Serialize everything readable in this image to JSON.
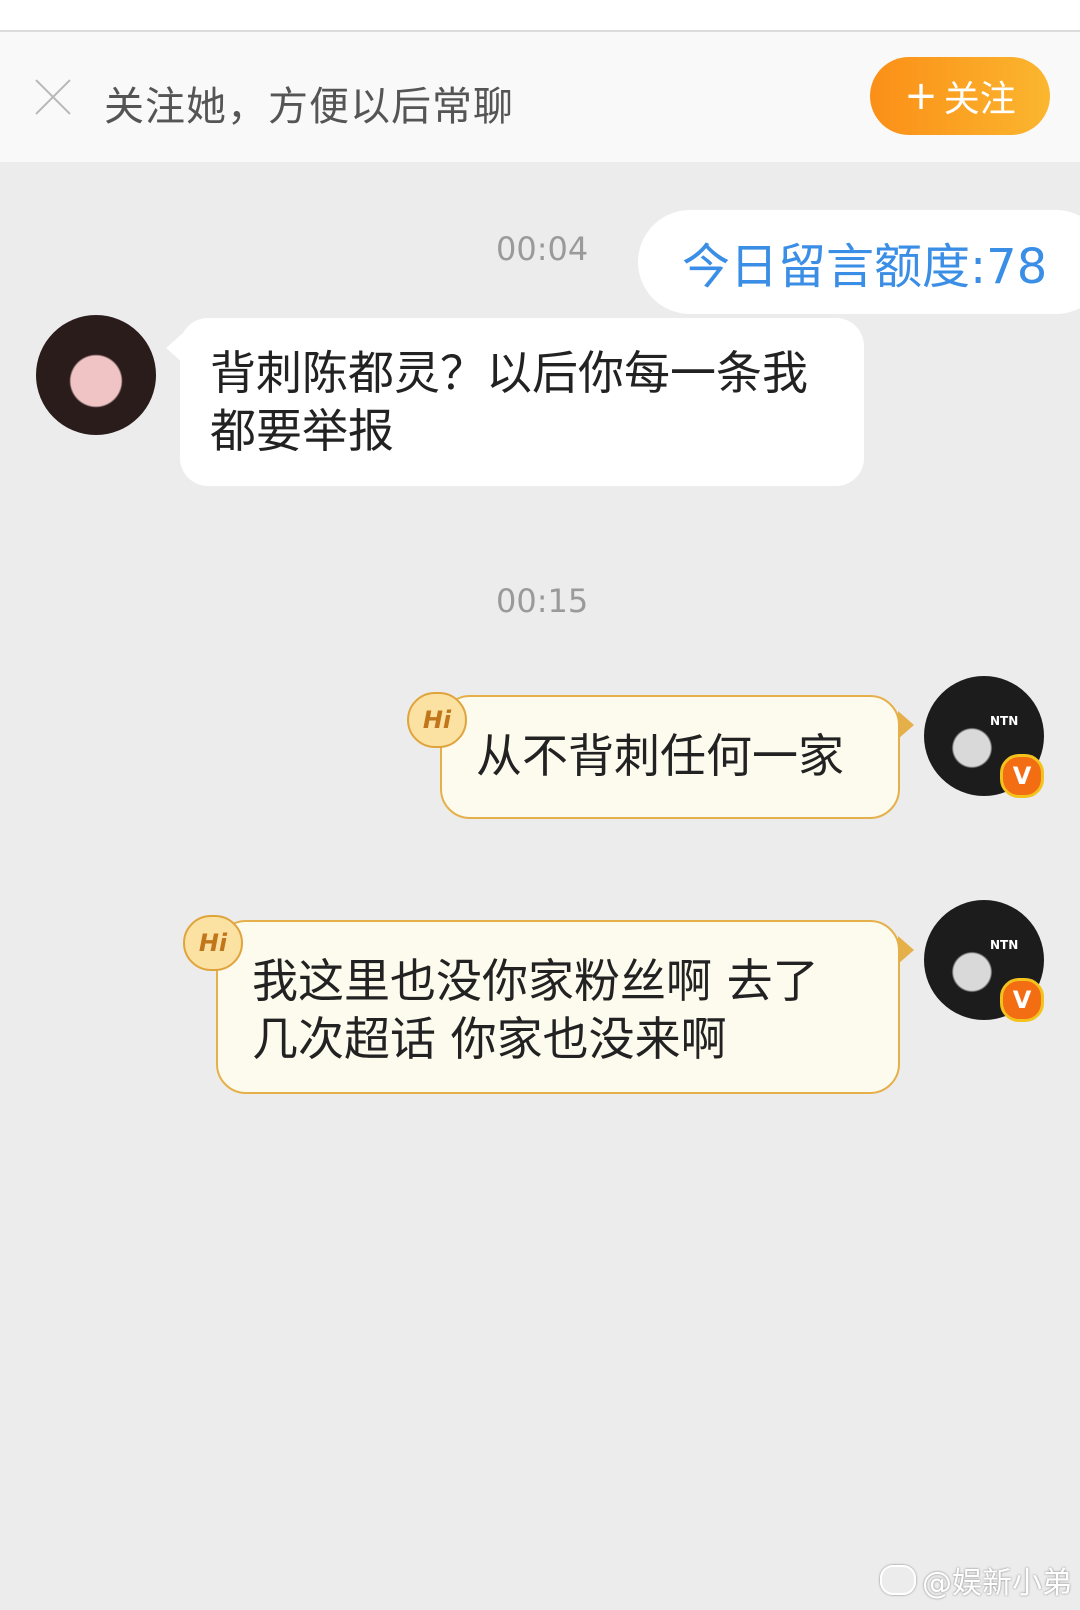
{
  "follow_bar": {
    "hint": "关注她，方便以后常聊",
    "follow_button": "关注",
    "follow_button_icon": "plus-icon",
    "close_icon": "close-icon"
  },
  "messages": [
    {
      "time": "00:04"
    },
    {
      "quota_text": "今日留言额度:78"
    },
    {
      "sender": "her",
      "text_line1": "背刺陈都灵？以后你每一条我",
      "text_line2": "都要举报"
    },
    {
      "time": "00:15"
    },
    {
      "sender": "him",
      "hi_badge": "Hi",
      "text_line1": "从不背刺任何一家",
      "verified_badge": "V"
    },
    {
      "sender": "him",
      "hi_badge": "Hi",
      "text_line1": "我这里也没你家粉丝啊 去了",
      "text_line2": "几次超话 你家也没来啊",
      "verified_badge": "V"
    }
  ],
  "avatar_cap_text": "NTN",
  "watermark": "@娱新小弟",
  "colors": {
    "background": "#ececec",
    "follow_button": "#fb9a1f",
    "quota_text": "#3b8ee5",
    "hi_bubble_fill": "#fdfaee",
    "hi_bubble_border": "#e5b04a"
  }
}
